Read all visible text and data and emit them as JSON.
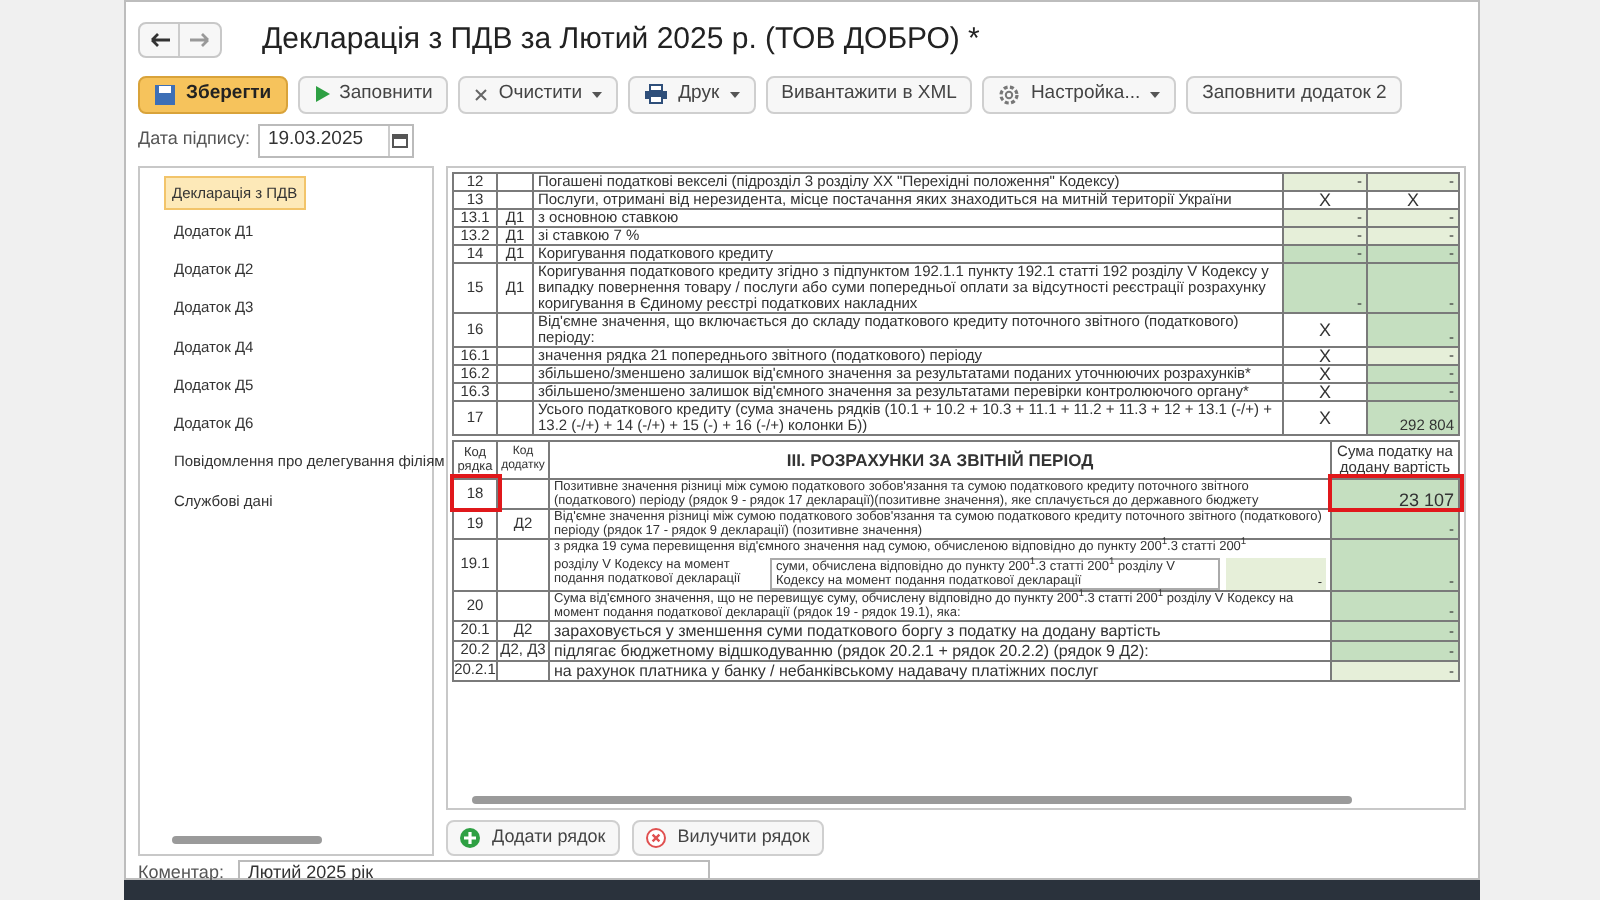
{
  "window": {
    "title": "Декларація з ПДВ за Лютий 2025 р. (ТОВ ДОБРО) *"
  },
  "toolbar": [
    {
      "kind": "save",
      "label": "Зберегти"
    },
    {
      "kind": "play",
      "label": "Заповнити"
    },
    {
      "kind": "clear",
      "label": "Очистити",
      "dropdown": true
    },
    {
      "kind": "print",
      "label": "Друк",
      "dropdown": true
    },
    {
      "kind": "plain",
      "label": "Вивантажити в XML"
    },
    {
      "kind": "settings",
      "label": "Настройка...",
      "dropdown": true
    },
    {
      "kind": "plain",
      "label": "Заповнити додаток 2"
    }
  ],
  "sign_date": {
    "label": "Дата підпису:",
    "value": "19.03.2025"
  },
  "sidebar": {
    "items": [
      {
        "label": "Декларація з ПДВ",
        "selected": true
      },
      {
        "label": "Додаток Д1",
        "selected": false
      },
      {
        "label": "Додаток Д2",
        "selected": false
      },
      {
        "label": "Додаток Д3",
        "selected": false
      },
      {
        "label": "Додаток Д4",
        "selected": false
      },
      {
        "label": "Додаток Д5",
        "selected": false
      },
      {
        "label": "Додаток Д6",
        "selected": false
      },
      {
        "label": "Повідомлення про делегування філіям",
        "selected": false
      },
      {
        "label": "Службові дані",
        "selected": false
      }
    ]
  },
  "section_2_rows": [
    {
      "code": "12",
      "addendum": "",
      "description": "Погашені податкові векселі (підрозділ 3 розділу XX \"Перехідні положення\" Кодексу)",
      "col_a": {
        "kind": "light",
        "text": "-"
      },
      "col_b": {
        "kind": "light",
        "text": "-"
      }
    },
    {
      "code": "13",
      "addendum": "",
      "description": "Послуги, отримані від нерезидента, місце постачання яких знаходиться на митній території України",
      "col_a": {
        "kind": "x",
        "text": "X"
      },
      "col_b": {
        "kind": "x",
        "text": "X"
      }
    },
    {
      "code": "13.1",
      "addendum": "Д1",
      "description": "з  основною ставкою",
      "col_a": {
        "kind": "light",
        "text": "-"
      },
      "col_b": {
        "kind": "light",
        "text": "-"
      }
    },
    {
      "code": "13.2",
      "addendum": "Д1",
      "description": "зі ставкою 7 %",
      "col_a": {
        "kind": "light",
        "text": "-"
      },
      "col_b": {
        "kind": "light",
        "text": "-"
      }
    },
    {
      "code": "14",
      "addendum": "Д1",
      "description": "Коригування податкового кредиту",
      "col_a": {
        "kind": "green",
        "text": "-"
      },
      "col_b": {
        "kind": "green",
        "text": "-"
      }
    },
    {
      "code": "15",
      "addendum": "Д1",
      "description": "Коригування податкового кредиту згідно з підпунктом 192.1.1 пункту 192.1 статті 192 розділу V Кодексу у випадку повернення товару / послуги або суми попередньої оплати за відсутності реєстрації розрахунку коригування в Єдиному реєстрі податкових накладних",
      "col_a": {
        "kind": "green",
        "text": "-"
      },
      "col_b": {
        "kind": "green",
        "text": "-"
      }
    },
    {
      "code": "16",
      "addendum": "",
      "description": "Від'ємне значення, що включається  до складу податкового кредиту поточного звітного (податкового) періоду:",
      "col_a": {
        "kind": "x",
        "text": "X"
      },
      "col_b": {
        "kind": "green",
        "text": "-"
      }
    },
    {
      "code": "16.1",
      "addendum": "",
      "description": "значення рядка 21 попереднього звітного (податкового) періоду",
      "col_a": {
        "kind": "x",
        "text": "X"
      },
      "col_b": {
        "kind": "light",
        "text": "-"
      }
    },
    {
      "code": "16.2",
      "addendum": "",
      "description": "збільшено/зменшено залишок від'ємного значення за результатами поданих уточнюючих розрахунків*",
      "col_a": {
        "kind": "x",
        "text": "X"
      },
      "col_b": {
        "kind": "green",
        "text": "-"
      }
    },
    {
      "code": "16.3",
      "addendum": "",
      "description": "збільшено/зменшено залишок  від'ємного значення за результатами перевірки контролюючого органу*",
      "col_a": {
        "kind": "x",
        "text": "X"
      },
      "col_b": {
        "kind": "green",
        "text": "-"
      }
    },
    {
      "code": "17",
      "addendum": "",
      "description": "Усього податкового кредиту (сума значень рядків (10.1 + 10.2 + 10.3 + 11.1 + 11.2 + 11.3 + 12 + 13.1 (-/+) + 13.2 (-/+) + 14 (-/+) + 15 (-) + 16 (-/+) колонки Б))",
      "col_a": {
        "kind": "x",
        "text": "X"
      },
      "col_b": {
        "kind": "green",
        "text": "292 804"
      }
    }
  ],
  "section_3": {
    "code_label": "Код рядка",
    "addendum_label": "Код додатку",
    "title": "III. РОЗРАХУНКИ ЗА ЗВІТНІЙ ПЕРІОД",
    "value_label": "Сума податку на додану вартість",
    "rows": [
      {
        "kind": "plain",
        "code": "18",
        "addendum": "",
        "description": "Позитивне значення різниці між сумою податкового зобов'язання та сумою податкового кредиту поточного звітного (податкового) періоду (рядок 9 - рядок 17 декларації)(позитивне значення), яке сплачується до державного бюджету",
        "value": {
          "kind": "green",
          "text": "23 107"
        },
        "highlighted": true
      },
      {
        "kind": "plain",
        "code": "19",
        "addendum": "Д2",
        "description": "Від'ємне значення різниці між сумою податкового зобов'язання та сумою податкового кредиту поточного звітного (податкового) періоду (рядок 17 - рядок 9 декларації) (позитивне значення)",
        "value": {
          "kind": "green",
          "text": "-"
        },
        "highlighted": false
      },
      {
        "kind": "split",
        "code": "19.1",
        "addendum": "",
        "description": "з рядка 19 сума перевищення від'ємного значення над сумою, обчисленою відповідно до пункту 200$^{1}$.3 статті 200$^{1}$",
        "sub_label": "розділу V Кодексу на момент подання податкової декларації",
        "sub_description": "суми, обчислена відповідно до пункту 200$^{1}$.3 статті 200$^{1}$ розділу V Кодексу на момент подання податкової декларації",
        "sub_value": "-",
        "value": {
          "kind": "green",
          "text": "-"
        },
        "highlighted": false
      },
      {
        "kind": "plain",
        "code": "20",
        "addendum": "",
        "description": "Сума від'ємного значення, що не перевищує суму, обчислену відповідно до пункту 200$^{1}$.3 статті 200$^{1}$ розділу V Кодексу на момент подання податкової декларації (рядок 19 - рядок 19.1), яка:",
        "value": {
          "kind": "green",
          "text": "-"
        },
        "highlighted": false
      },
      {
        "kind": "large",
        "code": "20.1",
        "addendum": "Д2",
        "description": "зараховується у зменшення суми податкового боргу з податку на додану вартість",
        "value": {
          "kind": "green",
          "text": "-"
        },
        "highlighted": false
      },
      {
        "kind": "large",
        "code": "20.2",
        "addendum": "Д2, Д3",
        "description": "підлягає бюджетному відшкодуванню (рядок 20.2.1 + рядок 20.2.2) (рядок 9 Д2):",
        "value": {
          "kind": "green",
          "text": "-"
        },
        "highlighted": false
      },
      {
        "kind": "large",
        "code": "20.2.1",
        "addendum": "",
        "description": "на рахунок платника у банку / небанківському надавачу платіжних послуг",
        "value": {
          "kind": "light",
          "text": "-"
        },
        "highlighted": false
      }
    ]
  },
  "row_buttons": [
    {
      "kind": "add",
      "label": "Додати рядок"
    },
    {
      "kind": "remove",
      "label": "Вилучити рядок"
    }
  ],
  "comment": {
    "label": "Коментар:",
    "value": "Лютий 2025 рік"
  }
}
